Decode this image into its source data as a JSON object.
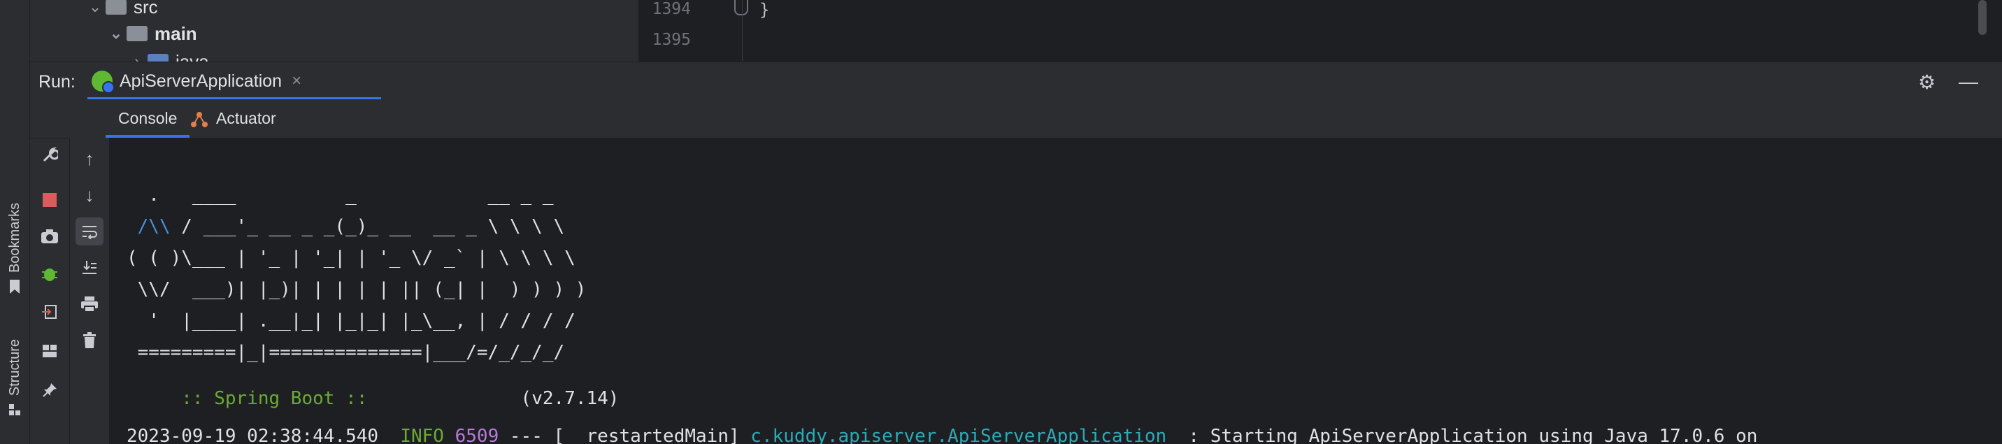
{
  "tree": {
    "rows": [
      {
        "label": "src"
      },
      {
        "label": "main"
      },
      {
        "label": "java"
      }
    ]
  },
  "editor": {
    "lines": [
      {
        "num": "1394",
        "code": "}"
      },
      {
        "num": "1395",
        "code": ""
      }
    ]
  },
  "left_stripe": {
    "bookmarks": "Bookmarks",
    "structure": "Structure"
  },
  "run": {
    "label": "Run:",
    "tab_name": "ApiServerApplication",
    "close_glyph": "×",
    "settings_icon": "gear-icon",
    "minimize_icon": "minimize-icon"
  },
  "subtabs": {
    "console": "Console",
    "actuator": "Actuator"
  },
  "console": {
    "banner": [
      "  .   ____          _            __ _ _",
      " /\\\\ / ___'_ __ _ _(_)_ __  __ _ \\ \\ \\ \\",
      "( ( )\\___ | '_ | '_| | '_ \\/ _` | \\ \\ \\ \\",
      " \\\\/  ___)| |_)| | | | | || (_| |  ) ) ) )",
      "  '  |____| .__|_| |_|_| |_\\__, | / / / /",
      " =========|_|==============|___/=/_/_/_/"
    ],
    "spring_boot_label": " :: Spring Boot :: ",
    "spring_boot_version": "(v2.7.14)",
    "log": {
      "timestamp": "2023-09-19 02:38:44.540",
      "level": "INFO",
      "pid": "6509",
      "sep": "--- [  restartedMain]",
      "logger": "c.kuddy.apiserver.ApiServerApplication",
      "message": "  : Starting ApiServerApplication using Java 17.0.6 on"
    }
  },
  "colors": {
    "accent": "#3574f0",
    "spring_green": "#6aab36",
    "pid_purple": "#b77bd8",
    "logger_teal": "#2aacb8",
    "stop_red": "#db5c5c"
  }
}
